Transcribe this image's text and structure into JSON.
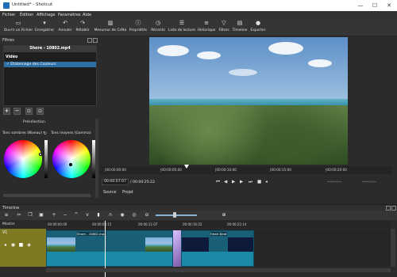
{
  "titlebar": {
    "title": "Untitled* - Shotcut",
    "minimize": "—",
    "maximize": "☐",
    "close": "✕"
  },
  "menu": [
    "Fichier",
    "Édition",
    "Affichage",
    "Paramètres",
    "Aide"
  ],
  "toolbar": [
    {
      "label": "Ouvrir un Fichier",
      "icon": "folder-open-icon",
      "glyph": "▭"
    },
    {
      "label": "Enregistrer",
      "icon": "save-icon",
      "glyph": "▾"
    },
    {
      "label": "Annuler",
      "icon": "undo-icon",
      "glyph": "↶"
    },
    {
      "label": "Rétablir",
      "icon": "redo-icon",
      "glyph": "↷"
    },
    {
      "label": "Mesureur de Crête",
      "icon": "peak-meter-icon",
      "glyph": "▥"
    },
    {
      "label": "Propriétés",
      "icon": "properties-icon",
      "glyph": "ⓘ"
    },
    {
      "label": "Récents",
      "icon": "recent-icon",
      "glyph": "◷"
    },
    {
      "label": "Liste de lecture",
      "icon": "playlist-icon",
      "glyph": "☰"
    },
    {
      "label": "Historique",
      "icon": "history-icon",
      "glyph": "≡"
    },
    {
      "label": "Filtres",
      "icon": "filters-icon",
      "glyph": "▽"
    },
    {
      "label": "Timeline",
      "icon": "timeline-icon",
      "glyph": "▤"
    },
    {
      "label": "Exporter",
      "icon": "export-icon",
      "glyph": "●"
    }
  ],
  "filters": {
    "panel_title": "Filtres",
    "file_name": "Shore - 10802.mp4",
    "section": "Vidéo",
    "item": "✓ Étalonnage des Couleurs",
    "preset_label": "Présélection",
    "shadows_label": "Tons sombres (Niveau)",
    "midtones_label": "Tons moyens (Gamma)"
  },
  "player": {
    "ruler_ticks": [
      "|00:00:00:00",
      "|00:00:05:00",
      "|00:00:10:00",
      "|00:00:15:00",
      "|00:00:20:00"
    ],
    "current_time": "00:00:07:07",
    "total_time": "/ 00:00:25:22",
    "in_point": "--:--:--:--",
    "out_point": "--:--:--:--",
    "tabs": [
      "Source",
      "Projet"
    ]
  },
  "timeline": {
    "panel_title": "Timeline",
    "master_label": "Master",
    "track_name": "V1",
    "ruler_ticks": [
      "00:00:00:00",
      "00:00:05:15",
      "00:00:11:07",
      "00:00:16:22",
      "00:00:22:14"
    ],
    "clips": [
      "Shore - 10802.mp4",
      "Heart Beat"
    ]
  },
  "colors": {
    "accent": "#2d6ea3",
    "track_head": "#7e7a22",
    "clip_wave": "#1b8aa8",
    "background": "#2b2b2b"
  }
}
